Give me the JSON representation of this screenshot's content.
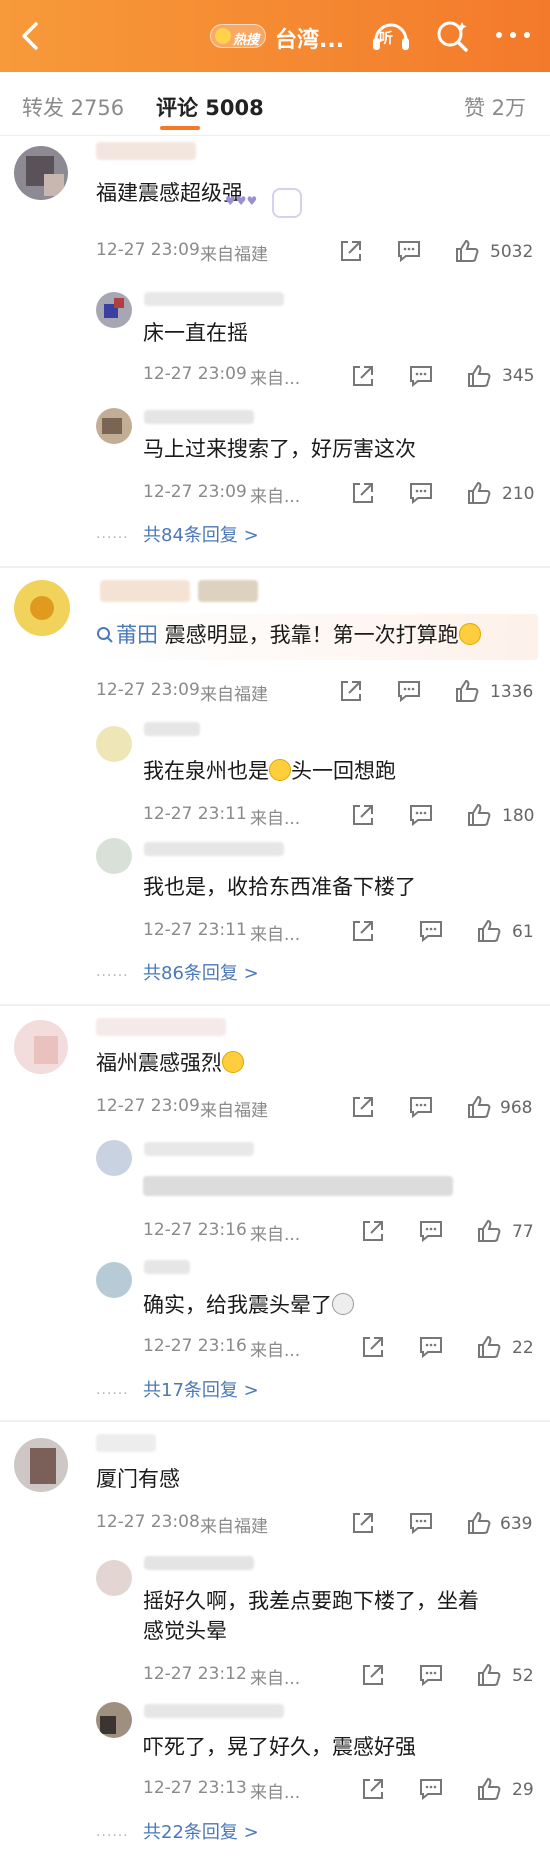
{
  "header": {
    "hot_label": "热搜",
    "title": "台湾...",
    "listen_label": "听",
    "back_icon": "chevron-left-icon",
    "search_icon": "search-icon",
    "more_icon": "more-icon"
  },
  "tabs": {
    "repost": "转发 2756",
    "comment": "评论 5008",
    "like": "赞 2万"
  },
  "comments": [
    {
      "text": "福建震感超级强",
      "time": "12-27 23:09",
      "location": "来自福建",
      "likes": "5032",
      "replies": [
        {
          "text": "床一直在摇",
          "time": "12-27 23:09",
          "location": "来自...",
          "likes": "345"
        },
        {
          "text": "马上过来搜索了，好厉害这次",
          "time": "12-27 23:09",
          "location": "来自...",
          "likes": "210"
        }
      ],
      "more": "共84条回复 >"
    },
    {
      "tag": "莆田",
      "text": " 震感明显，我靠！第一次打算跑",
      "time": "12-27 23:09",
      "location": "来自福建",
      "likes": "1336",
      "replies": [
        {
          "text_a": "我在泉州也是",
          "text_b": "头一回想跑",
          "time": "12-27 23:11",
          "location": "来自...",
          "likes": "180"
        },
        {
          "text": "我也是，收拾东西准备下楼了",
          "time": "12-27 23:11",
          "location": "来自...",
          "likes": "61"
        }
      ],
      "more": "共86条回复 >"
    },
    {
      "text": "福州震感强烈",
      "time": "12-27 23:09",
      "location": "来自福建",
      "likes": "968",
      "replies": [
        {
          "text": "",
          "time": "12-27 23:16",
          "location": "来自...",
          "likes": "77"
        },
        {
          "text": "确实，给我震头晕了",
          "time": "12-27 23:16",
          "location": "来自...",
          "likes": "22"
        }
      ],
      "more": "共17条回复 >"
    },
    {
      "text": "厦门有感",
      "time": "12-27 23:08",
      "location": "来自福建",
      "likes": "639",
      "replies": [
        {
          "text_line1": "摇好久啊，我差点要跑下楼了，坐着",
          "text_line2": "感觉头晕",
          "time": "12-27 23:12",
          "location": "来自...",
          "likes": "52"
        },
        {
          "text": "吓死了，晃了好久，震感好强",
          "time": "12-27 23:13",
          "location": "来自...",
          "likes": "29"
        }
      ],
      "more": "共22条回复 >"
    }
  ],
  "dots": "......",
  "colors": {
    "header": "#f37a2b",
    "link": "#4b79b8",
    "meta": "#8a8a8a"
  }
}
